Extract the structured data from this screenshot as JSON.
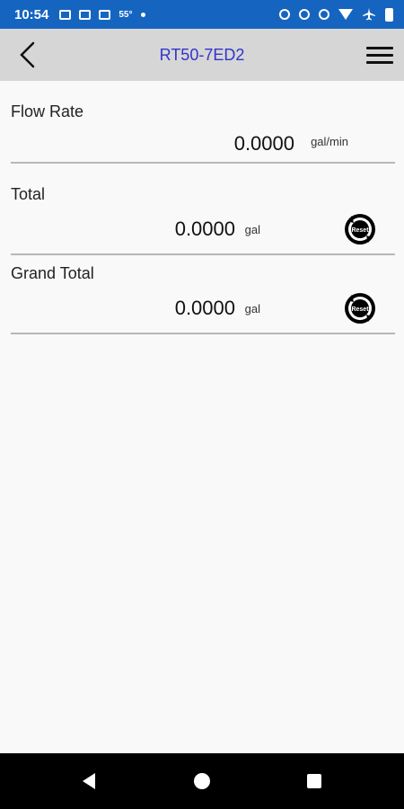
{
  "status_bar": {
    "time": "10:54",
    "temperature": "55°",
    "icons": [
      "photo-icon",
      "mail-icon",
      "news-icon",
      "dot-icon",
      "alarm-icon",
      "data-saver-icon",
      "vibrate-icon",
      "wifi-icon",
      "airplane-icon",
      "battery-icon"
    ]
  },
  "header": {
    "title": "RT50-7ED2",
    "back_icon": "chevron-left-icon",
    "menu_icon": "hamburger-menu-icon"
  },
  "rows": {
    "flow_rate": {
      "label": "Flow Rate",
      "value": "0.0000",
      "unit": "gal/min"
    },
    "total": {
      "label": "Total",
      "value": "0.0000",
      "unit": "gal",
      "reset_label": "Reset"
    },
    "grand_total": {
      "label": "Grand Total",
      "value": "0.0000",
      "unit": "gal",
      "reset_label": "Reset"
    }
  },
  "nav_bar": {
    "icons": [
      "nav-back-icon",
      "nav-home-icon",
      "nav-recents-icon"
    ]
  },
  "colors": {
    "status_bar": "#1565c0",
    "header_bg": "#d6d6d6",
    "title": "#3333cc",
    "background": "#f9f9f9",
    "nav_bar": "#000000"
  }
}
